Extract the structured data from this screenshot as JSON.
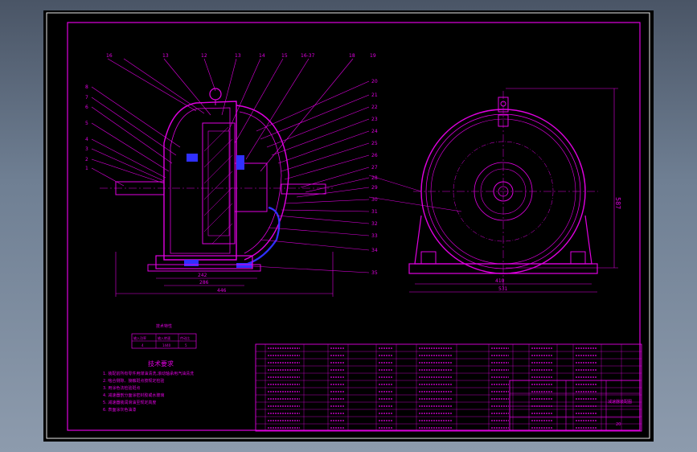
{
  "drawing": {
    "dimensions": {
      "side_view_width": "587",
      "base_width_left": "446",
      "base_width_right": "531",
      "inner_left_a": "242",
      "inner_left_b": "286",
      "inner_right": "410"
    },
    "balloon_labels_top": [
      "16",
      "13",
      "12",
      "13",
      "14",
      "15",
      "16-37",
      "18",
      "19"
    ],
    "balloon_labels_left": [
      "8",
      "7",
      "6",
      "5",
      "4",
      "3",
      "2",
      "1"
    ],
    "balloon_labels_right": [
      "20",
      "21",
      "22",
      "23",
      "24",
      "25",
      "26",
      "27",
      "28",
      "29",
      "30",
      "31",
      "32",
      "33",
      "34",
      "35"
    ],
    "tech_req": {
      "title": "技术要求",
      "lines": [
        "1. 装配前所有零件用煤油清洗,滚动轴承用汽油清洗",
        "2. 啮合侧隙、接触斑点按规定检验",
        "3. 用涂色法检验斑点",
        "4. 减速器剖分面涂密封胶或水玻璃",
        "5. 减速器装润滑油至规定高度",
        "6. 表面涂灰色油漆"
      ]
    },
    "spec_table": {
      "title": "技术特性",
      "headers": [
        "输入功率",
        "输入转速",
        "传动比"
      ],
      "values": [
        "4",
        "1440",
        "5"
      ]
    },
    "title_block": {
      "name": "减速器装配图",
      "number": "20"
    }
  }
}
